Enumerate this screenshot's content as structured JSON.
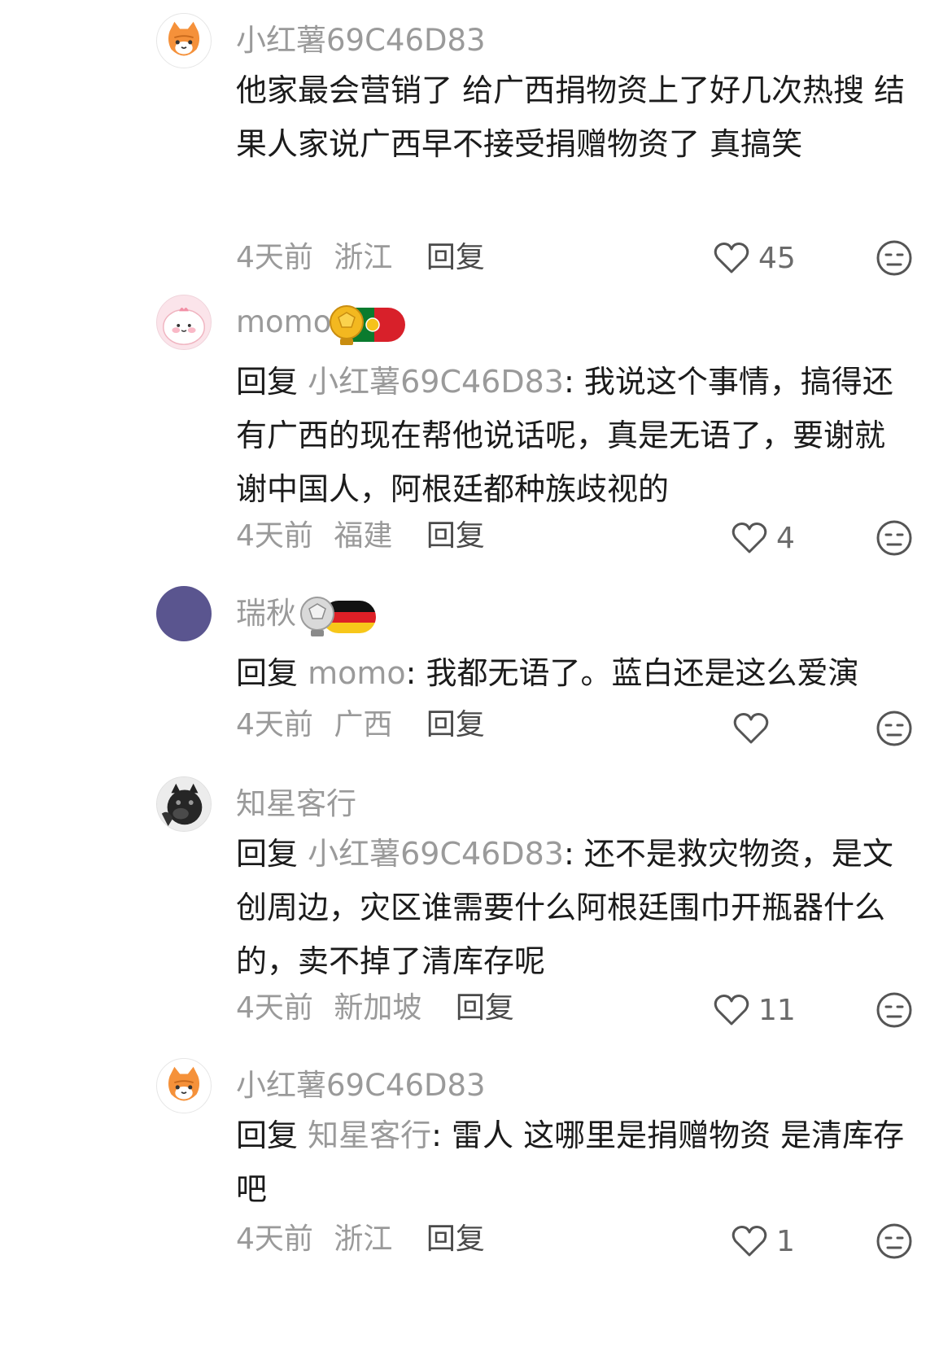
{
  "comments": [
    {
      "username": "小红薯69C46D83",
      "avatar": "cat-avatar",
      "reply_prefix": "",
      "reply_target": "",
      "text": "他家最会营销了 给广西捐物资上了好几次热搜 结果人家说广西早不接受捐赠物资了 真搞笑",
      "time": "4天前",
      "region": "浙江",
      "reply_label": "回复",
      "likes": "45"
    },
    {
      "username": "momo",
      "avatar": "pink-character-avatar",
      "badge": "portugal-flag-badge",
      "reply_prefix": "回复 ",
      "reply_target": "小红薯69C46D83",
      "text": ": 我说这个事情，搞得还有广西的现在帮他说话呢，真是无语了，要谢就谢中国人，阿根廷都种族歧视的",
      "time": "4天前",
      "region": "福建",
      "reply_label": "回复",
      "likes": "4"
    },
    {
      "username": "瑞秋",
      "avatar": "purple-avatar",
      "badge": "germany-flag-badge",
      "reply_prefix": "回复 ",
      "reply_target": "momo",
      "text": ": 我都无语了。蓝白还是这么爱演",
      "time": "4天前",
      "region": "广西",
      "reply_label": "回复",
      "likes": ""
    },
    {
      "username": "知星客行",
      "avatar": "dog-avatar",
      "reply_prefix": "回复 ",
      "reply_target": "小红薯69C46D83",
      "text": ": 还不是救灾物资，是文创周边，灾区谁需要什么阿根廷围巾开瓶器什么的，卖不掉了清库存呢",
      "time": "4天前",
      "region": "新加坡",
      "reply_label": "回复",
      "likes": "11"
    },
    {
      "username": "小红薯69C46D83",
      "avatar": "cat-avatar",
      "reply_prefix": "回复 ",
      "reply_target": "知星客行",
      "text": ": 雷人 这哪里是捐赠物资 是清库存吧",
      "time": "4天前",
      "region": "浙江",
      "reply_label": "回复",
      "likes": "1"
    }
  ],
  "colors": {
    "secondary_text": "#9a9a9a",
    "body_text": "#1b1b1b"
  }
}
